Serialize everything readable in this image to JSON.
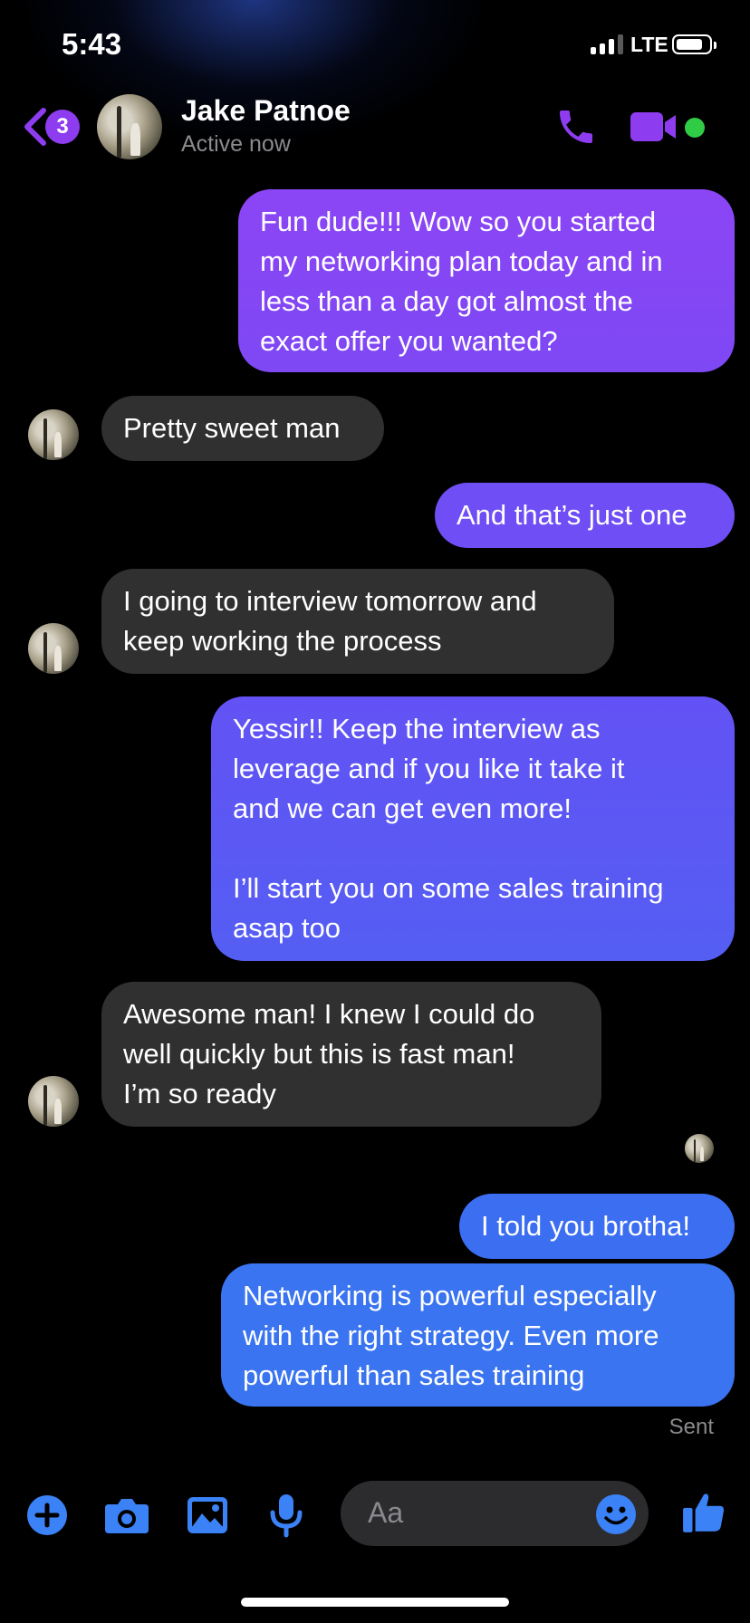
{
  "status_bar": {
    "time": "5:43",
    "network": "LTE"
  },
  "header": {
    "back_badge_count": "3",
    "contact_name": "Jake Patnoe",
    "contact_status": "Active now",
    "icons": [
      "back-chevron-icon",
      "phone-icon",
      "video-camera-icon"
    ]
  },
  "messages": [
    {
      "from": "me",
      "text": "Fun dude!!! Wow so you started\nmy networking plan today and in\nless than a day got almost the\nexact offer you wanted?"
    },
    {
      "from": "them",
      "text": "Pretty sweet man"
    },
    {
      "from": "me",
      "text": "And that’s just one"
    },
    {
      "from": "them",
      "text": "I going to interview tomorrow and\nkeep working the process"
    },
    {
      "from": "me",
      "text": "Yessir!! Keep the interview as\nleverage and if you like it take it\nand we can get even more!\n\nI’ll start you on some sales training\nasap too"
    },
    {
      "from": "them",
      "text": "Awesome man! I knew I could do\nwell quickly but this is fast man!\nI’m so ready"
    },
    {
      "from": "me",
      "text": "I told you brotha!"
    },
    {
      "from": "me",
      "text": "Networking is powerful especially\nwith the right strategy. Even more\npowerful than sales training"
    }
  ],
  "delivery_status": "Sent",
  "composer": {
    "placeholder": "Aa",
    "icons": [
      "plus-icon",
      "camera-icon",
      "photo-icon",
      "microphone-icon",
      "emoji-icon",
      "thumbs-up-icon"
    ]
  },
  "colors": {
    "accent_purple": "#8e3cf0",
    "bubble_gradient_top": "#8b45f5",
    "bubble_gradient_bottom": "#3a74f0",
    "incoming_bubble": "#303030",
    "composer_blue": "#3b82f6",
    "online_green": "#31cc46"
  }
}
